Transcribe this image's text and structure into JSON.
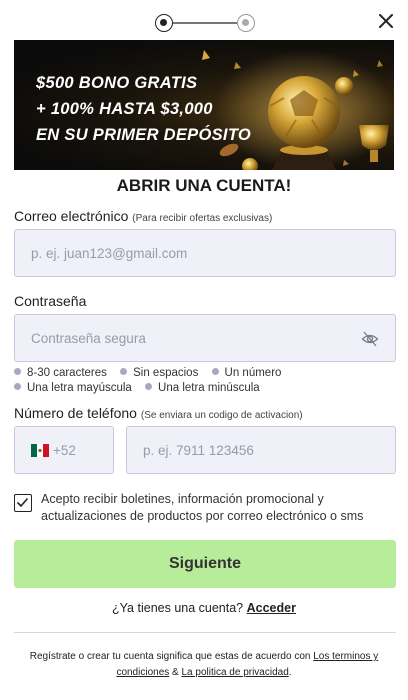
{
  "banner": {
    "line1": "$500 BONO GRATIS",
    "line2": "+ 100% HASTA $3,000",
    "line3": "EN SU PRIMER DEPÓSITO"
  },
  "title": "ABRIR UNA CUENTA!",
  "email": {
    "label": "Correo electrónico",
    "hint": "(Para recibir ofertas exclusivas)",
    "placeholder": "p. ej. juan123@gmail.com"
  },
  "password": {
    "label": "Contraseña",
    "placeholder": "Contraseña segura",
    "rules": [
      "8-30 caracteres",
      "Sin espacios",
      "Un número",
      "Una letra mayúscula",
      "Una letra minúscula"
    ]
  },
  "phone": {
    "label": "Número de teléfono",
    "hint": "(Se enviara un codigo de activacion)",
    "country_code": "+52",
    "placeholder": "p. ej. 7911 123456"
  },
  "consent": {
    "text": "Acepto recibir boletines, información promocional y actualizaciones de productos por correo electrónico o sms",
    "checked": true
  },
  "next_label": "Siguiente",
  "login": {
    "prompt": "¿Ya tienes una cuenta?",
    "link": "Acceder"
  },
  "terms": {
    "prefix": "Regístrate o crear tu cuenta significa que estas de acuerdo con",
    "link1": "Los terminos y condiciones",
    "amp": "&",
    "link2": "La politica de privacidad",
    "suffix": "."
  },
  "colors": {
    "next_button": "#b7ec9a",
    "input_bg": "#f0f0f8",
    "rule_dot": "#a8a8c0"
  }
}
